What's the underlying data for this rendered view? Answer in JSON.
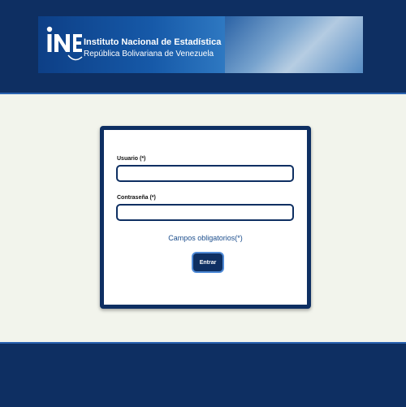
{
  "header": {
    "logo_text": "INE",
    "title": "Instituto Nacional de Estadística",
    "subtitle": "República Bolivariana de Venezuela"
  },
  "login": {
    "username_label": "Usuario (*)",
    "username_value": "",
    "password_label": "Contraseña (*)",
    "password_value": "",
    "required_note": "Campos obligatorios(*)",
    "submit_label": "Entrar"
  },
  "colors": {
    "navy": "#0e2f62",
    "accent_border": "#2a62b0",
    "page_background": "#f2f4ec",
    "note_text": "#1b4d8c"
  }
}
